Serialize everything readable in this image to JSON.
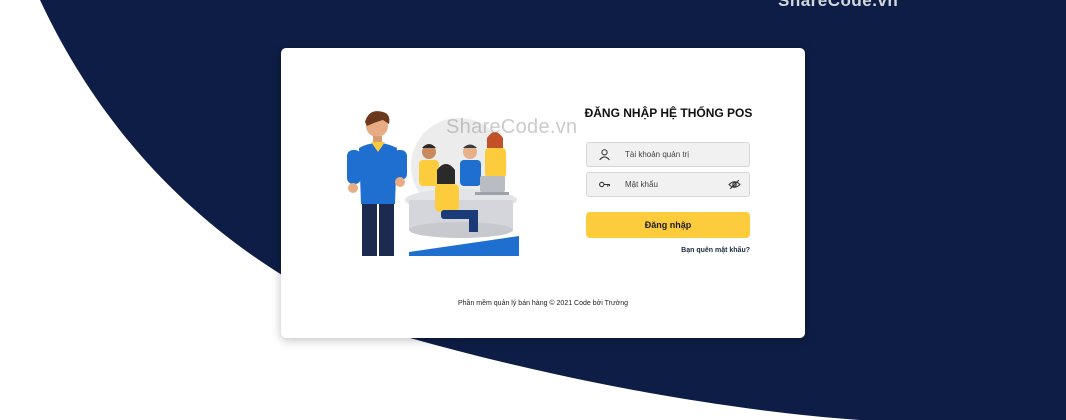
{
  "brand": {
    "watermark": "ShareCode.vn",
    "top_watermark": "ShareCode.vn"
  },
  "login": {
    "title": "ĐĂNG NHẬP HỆ THỐNG POS",
    "username_placeholder": "Tài khoản quản trị",
    "password_placeholder": "Mật khẩu",
    "submit_label": "Đăng nhập",
    "forgot_label": "Bạn quên mật khẩu?"
  },
  "footer": {
    "text": "Phần mềm quản lý bán hàng © 2021 Code bởi Trường"
  },
  "icons": {
    "user": "user-icon",
    "key": "key-icon",
    "eye_off": "eye-off-icon"
  },
  "colors": {
    "background_navy": "#0d1d45",
    "accent_yellow": "#fdcc3d",
    "field_bg": "#f1f1f2",
    "illustration_blue": "#1f6fd1"
  }
}
